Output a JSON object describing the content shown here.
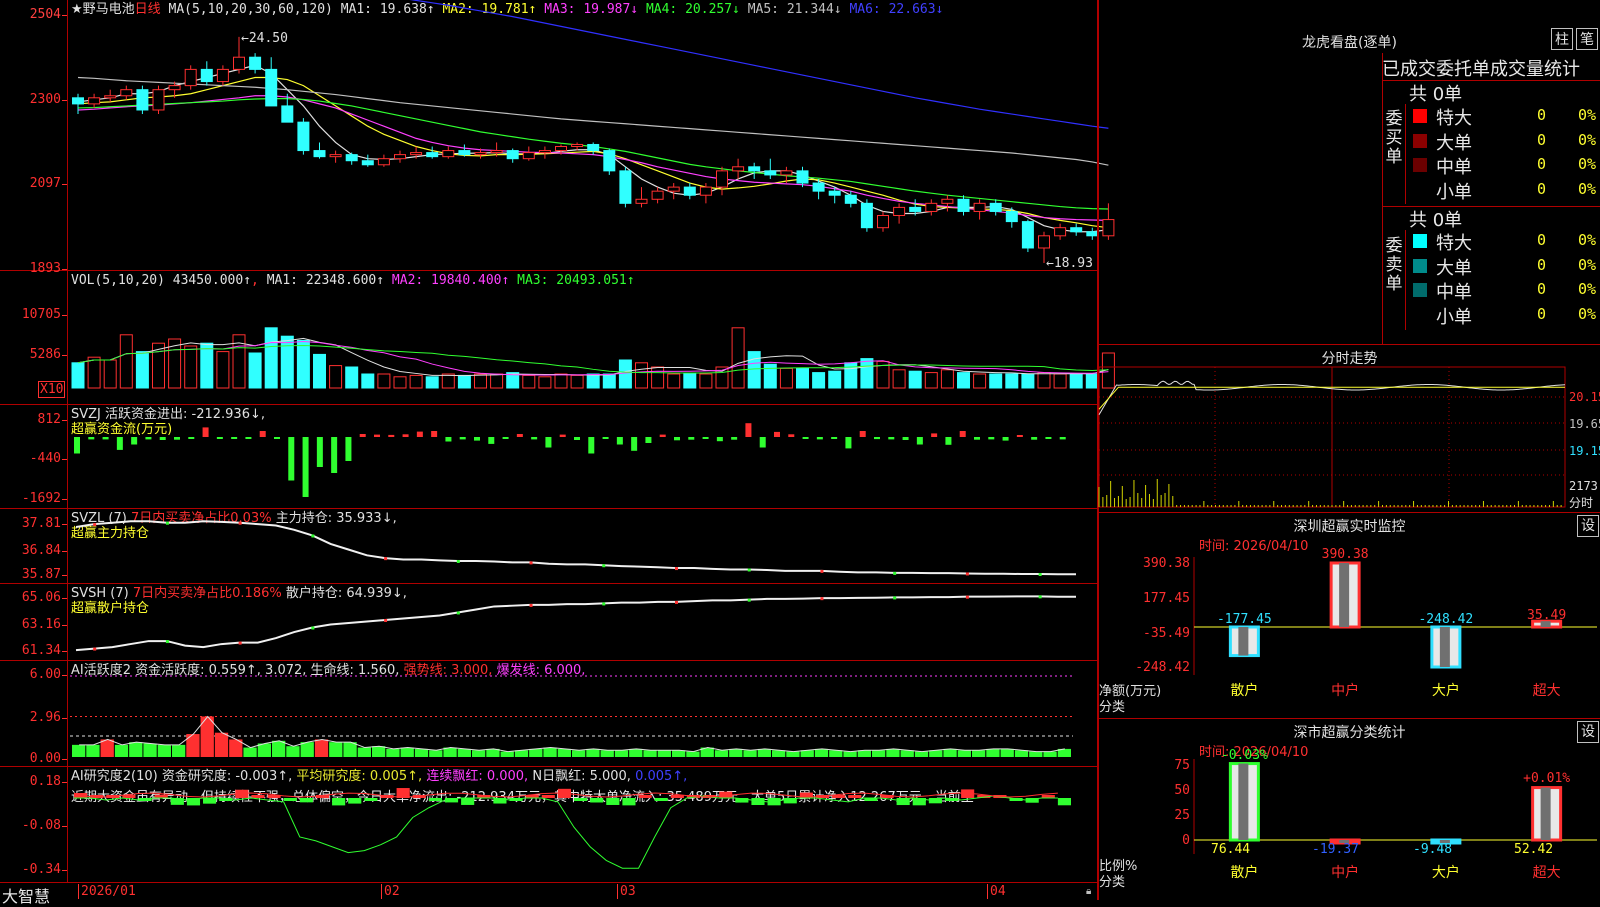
{
  "stock": {
    "name": "★野马电池",
    "period": "日线",
    "ma_label": "MA(5,10,20,30,60,120)",
    "ma": [
      {
        "label": "MA1: 19.638↑",
        "color": "#e0e0e0"
      },
      {
        "label": "MA2: 19.781↑",
        "color": "#ffff30"
      },
      {
        "label": "MA3: 19.987↓",
        "color": "#ff40ff"
      },
      {
        "label": "MA4: 20.257↓",
        "color": "#30ff30"
      },
      {
        "label": "MA5: 21.344↓",
        "color": "#c0c0c0"
      },
      {
        "label": "MA6: 22.663↓",
        "color": "#4040ff"
      }
    ],
    "price_ticks": [
      "2504",
      "2300",
      "2097",
      "1893"
    ],
    "high_label": "24.50",
    "low_label": "18.93",
    "candles": [
      [
        23.0,
        23.1,
        22.6,
        22.85
      ],
      [
        22.85,
        23.1,
        22.75,
        23.0
      ],
      [
        23.0,
        23.2,
        22.9,
        23.05
      ],
      [
        23.05,
        23.3,
        22.95,
        23.2
      ],
      [
        23.2,
        23.3,
        22.6,
        22.7
      ],
      [
        22.7,
        23.3,
        22.6,
        23.2
      ],
      [
        23.2,
        23.4,
        23.0,
        23.3
      ],
      [
        23.3,
        23.8,
        23.2,
        23.7
      ],
      [
        23.7,
        23.9,
        23.3,
        23.4
      ],
      [
        23.4,
        23.8,
        23.3,
        23.7
      ],
      [
        23.7,
        24.5,
        23.6,
        24.0
      ],
      [
        24.0,
        24.1,
        23.6,
        23.7
      ],
      [
        23.7,
        24.0,
        23.2,
        22.8
      ],
      [
        22.8,
        23.1,
        22.4,
        22.4
      ],
      [
        22.4,
        22.5,
        21.6,
        21.7
      ],
      [
        21.7,
        21.9,
        21.5,
        21.55
      ],
      [
        21.55,
        21.7,
        21.4,
        21.6
      ],
      [
        21.6,
        21.65,
        21.35,
        21.45
      ],
      [
        21.45,
        21.6,
        21.3,
        21.35
      ],
      [
        21.35,
        21.6,
        21.3,
        21.5
      ],
      [
        21.5,
        21.7,
        21.4,
        21.6
      ],
      [
        21.6,
        21.8,
        21.5,
        21.65
      ],
      [
        21.65,
        21.8,
        21.5,
        21.55
      ],
      [
        21.55,
        21.8,
        21.5,
        21.7
      ],
      [
        21.7,
        21.85,
        21.55,
        21.6
      ],
      [
        21.6,
        21.75,
        21.5,
        21.65
      ],
      [
        21.65,
        21.9,
        21.55,
        21.7
      ],
      [
        21.7,
        21.75,
        21.4,
        21.5
      ],
      [
        21.5,
        21.8,
        21.45,
        21.65
      ],
      [
        21.65,
        21.8,
        21.5,
        21.7
      ],
      [
        21.7,
        21.85,
        21.6,
        21.8
      ],
      [
        21.8,
        21.9,
        21.7,
        21.85
      ],
      [
        21.85,
        21.9,
        21.6,
        21.7
      ],
      [
        21.7,
        21.75,
        21.1,
        21.2
      ],
      [
        21.2,
        21.3,
        20.3,
        20.4
      ],
      [
        20.4,
        20.8,
        20.3,
        20.5
      ],
      [
        20.5,
        20.8,
        20.4,
        20.7
      ],
      [
        20.7,
        20.9,
        20.5,
        20.8
      ],
      [
        20.8,
        20.9,
        20.5,
        20.6
      ],
      [
        20.6,
        20.9,
        20.4,
        20.8
      ],
      [
        20.8,
        21.3,
        20.6,
        21.2
      ],
      [
        21.2,
        21.5,
        21.0,
        21.3
      ],
      [
        21.3,
        21.4,
        21.0,
        21.2
      ],
      [
        21.2,
        21.5,
        21.0,
        21.1
      ],
      [
        21.1,
        21.3,
        20.9,
        21.2
      ],
      [
        21.2,
        21.3,
        20.8,
        20.9
      ],
      [
        20.9,
        21.0,
        20.5,
        20.7
      ],
      [
        20.7,
        20.8,
        20.4,
        20.6
      ],
      [
        20.6,
        20.7,
        20.3,
        20.4
      ],
      [
        20.4,
        20.5,
        19.7,
        19.8
      ],
      [
        19.8,
        20.2,
        19.7,
        20.1
      ],
      [
        20.1,
        20.4,
        19.9,
        20.3
      ],
      [
        20.3,
        20.5,
        20.1,
        20.2
      ],
      [
        20.2,
        20.5,
        20.1,
        20.4
      ],
      [
        20.4,
        20.6,
        20.2,
        20.5
      ],
      [
        20.5,
        20.6,
        20.1,
        20.2
      ],
      [
        20.2,
        20.5,
        20.0,
        20.4
      ],
      [
        20.4,
        20.5,
        20.1,
        20.2
      ],
      [
        20.2,
        20.3,
        19.8,
        19.95
      ],
      [
        19.95,
        20.0,
        19.2,
        19.3
      ],
      [
        19.3,
        19.7,
        18.93,
        19.6
      ],
      [
        19.6,
        19.9,
        19.5,
        19.8
      ],
      [
        19.8,
        19.9,
        19.6,
        19.7
      ],
      [
        19.7,
        19.8,
        19.5,
        19.6
      ],
      [
        19.6,
        20.4,
        19.5,
        20.0
      ]
    ],
    "ma_series": {
      "ma1": [
        22.9,
        22.95,
        23.0,
        23.1,
        23.1,
        23.15,
        23.3,
        23.4,
        23.5,
        23.6,
        23.7,
        23.8,
        23.6,
        23.2,
        22.8,
        22.3,
        21.9,
        21.6,
        21.5,
        21.48,
        21.5,
        21.55,
        21.6,
        21.62,
        21.63,
        21.64,
        21.65,
        21.62,
        21.62,
        21.63,
        21.68,
        21.72,
        21.72,
        21.6,
        21.3,
        21.0,
        20.8,
        20.65,
        20.6,
        20.65,
        20.8,
        21.0,
        21.15,
        21.2,
        21.2,
        21.1,
        20.95,
        20.8,
        20.6,
        20.35,
        20.2,
        20.15,
        20.15,
        20.2,
        20.3,
        20.3,
        20.3,
        20.32,
        20.25,
        20.05,
        19.85,
        19.75,
        19.7,
        19.7,
        19.75
      ],
      "ma2": [
        22.85,
        22.88,
        22.9,
        22.95,
        23.0,
        23.02,
        23.05,
        23.1,
        23.2,
        23.3,
        23.4,
        23.5,
        23.5,
        23.45,
        23.3,
        23.05,
        22.8,
        22.55,
        22.3,
        22.1,
        21.95,
        21.8,
        21.7,
        21.62,
        21.58,
        21.57,
        21.6,
        21.6,
        21.61,
        21.62,
        21.64,
        21.66,
        21.68,
        21.62,
        21.5,
        21.35,
        21.2,
        21.05,
        20.9,
        20.8,
        20.75,
        20.78,
        20.82,
        20.88,
        20.95,
        21.0,
        20.98,
        20.9,
        20.8,
        20.7,
        20.6,
        20.48,
        20.38,
        20.32,
        20.3,
        20.28,
        20.26,
        20.25,
        20.22,
        20.15,
        20.05,
        19.98,
        19.92,
        19.85,
        19.8
      ],
      "ma3": [
        22.7,
        22.72,
        22.75,
        22.78,
        22.8,
        22.82,
        22.85,
        22.88,
        22.92,
        22.96,
        23.0,
        23.05,
        23.05,
        23.02,
        22.95,
        22.85,
        22.75,
        22.6,
        22.45,
        22.3,
        22.15,
        22.0,
        21.9,
        21.82,
        21.76,
        21.72,
        21.7,
        21.68,
        21.66,
        21.65,
        21.64,
        21.62,
        21.6,
        21.55,
        21.48,
        21.4,
        21.3,
        21.22,
        21.14,
        21.06,
        21.0,
        20.96,
        20.92,
        20.9,
        20.88,
        20.86,
        20.82,
        20.76,
        20.7,
        20.6,
        20.52,
        20.45,
        20.4,
        20.36,
        20.32,
        20.28,
        20.24,
        20.2,
        20.16,
        20.1,
        20.05,
        20.02,
        20.0,
        19.99,
        19.98
      ],
      "ma4": [
        22.75,
        22.76,
        22.78,
        22.8,
        22.82,
        22.84,
        22.86,
        22.88,
        22.9,
        22.92,
        22.95,
        22.97,
        22.98,
        22.98,
        22.96,
        22.92,
        22.86,
        22.8,
        22.72,
        22.64,
        22.56,
        22.48,
        22.4,
        22.32,
        22.24,
        22.16,
        22.1,
        22.04,
        21.98,
        21.93,
        21.88,
        21.84,
        21.8,
        21.74,
        21.68,
        21.6,
        21.52,
        21.44,
        21.36,
        21.3,
        21.25,
        21.2,
        21.16,
        21.12,
        21.08,
        21.05,
        21.02,
        20.98,
        20.94,
        20.88,
        20.82,
        20.76,
        20.7,
        20.65,
        20.6,
        20.56,
        20.52,
        20.48,
        20.44,
        20.4,
        20.36,
        20.32,
        20.29,
        20.27,
        20.26
      ],
      "ma5": [
        23.5,
        23.48,
        23.45,
        23.42,
        23.4,
        23.38,
        23.36,
        23.34,
        23.32,
        23.3,
        23.28,
        23.26,
        23.23,
        23.2,
        23.16,
        23.12,
        23.08,
        23.03,
        22.98,
        22.93,
        22.88,
        22.84,
        22.8,
        22.76,
        22.72,
        22.68,
        22.64,
        22.6,
        22.56,
        22.52,
        22.48,
        22.45,
        22.42,
        22.39,
        22.36,
        22.33,
        22.3,
        22.27,
        22.24,
        22.21,
        22.18,
        22.15,
        22.12,
        22.09,
        22.06,
        22.03,
        22.0,
        21.97,
        21.94,
        21.91,
        21.88,
        21.85,
        21.82,
        21.79,
        21.76,
        21.73,
        21.7,
        21.67,
        21.64,
        21.6,
        21.56,
        21.52,
        21.48,
        21.42,
        21.34
      ],
      "ma6": [
        25.8,
        25.82,
        25.83,
        25.84,
        25.85,
        25.86,
        25.86,
        25.86,
        25.85,
        25.84,
        25.83,
        25.82,
        25.8,
        25.77,
        25.74,
        25.7,
        25.66,
        25.62,
        25.57,
        25.52,
        25.46,
        25.4,
        25.34,
        25.28,
        25.21,
        25.14,
        25.07,
        25.0,
        24.92,
        24.84,
        24.76,
        24.68,
        24.6,
        24.52,
        24.44,
        24.36,
        24.28,
        24.2,
        24.12,
        24.04,
        23.96,
        23.88,
        23.8,
        23.72,
        23.64,
        23.56,
        23.48,
        23.4,
        23.32,
        23.24,
        23.16,
        23.08,
        23.0,
        22.93,
        22.86,
        22.79,
        22.72,
        22.66,
        22.6,
        22.54,
        22.48,
        22.42,
        22.36,
        22.3,
        22.25
      ]
    }
  },
  "volume": {
    "title": "VOL(5,10,20)",
    "value": "43450.000↑",
    "ma": [
      {
        "label": "MA1: 22348.600↑",
        "color": "#e0e0e0"
      },
      {
        "label": "MA2: 19840.400↑",
        "color": "#ff40ff"
      },
      {
        "label": "MA3: 20493.051↑",
        "color": "#30ff30"
      }
    ],
    "ticks": [
      "10705",
      "5286"
    ],
    "multiplier": "X10",
    "bars": [
      1.8,
      2.2,
      2.0,
      3.8,
      2.6,
      3.2,
      3.5,
      3.0,
      3.2,
      2.6,
      3.8,
      2.5,
      4.3,
      3.7,
      3.4,
      2.4,
      1.6,
      1.5,
      1.0,
      1.0,
      0.8,
      0.9,
      0.8,
      1.0,
      0.9,
      1.0,
      1.0,
      1.1,
      0.9,
      0.8,
      1.0,
      0.9,
      1.0,
      1.0,
      2.0,
      1.8,
      1.5,
      1.0,
      1.0,
      1.0,
      1.5,
      4.3,
      2.6,
      1.7,
      1.4,
      1.4,
      1.1,
      1.2,
      1.8,
      2.1,
      1.9,
      1.3,
      1.2,
      1.1,
      1.3,
      1.1,
      1.0,
      1.0,
      1.0,
      1.0,
      1.1,
      1.0,
      1.0,
      1.0,
      2.5
    ]
  },
  "svzj": {
    "title": "SVZJ  活跃资金进出: -212.936↓,",
    "subtitle": "超赢资金流(万元)",
    "ticks": [
      "812",
      "-440",
      "-1692"
    ],
    "bars": [
      -550,
      -80,
      -80,
      -430,
      -250,
      -80,
      -100,
      -90,
      -50,
      320,
      -30,
      -50,
      -60,
      200,
      -50,
      -1450,
      -2000,
      -1000,
      -1200,
      -800,
      100,
      80,
      70,
      90,
      180,
      200,
      -150,
      -80,
      -120,
      -230,
      -60,
      100,
      -80,
      -350,
      80,
      -100,
      -550,
      -60,
      -250,
      -460,
      -200,
      80,
      -110,
      -90,
      -60,
      -140,
      -90,
      460,
      -350,
      170,
      90,
      -60,
      -80,
      -30,
      -380,
      200,
      -70,
      -80,
      -100,
      -250,
      120,
      -260,
      200,
      -90,
      -80,
      -120,
      60,
      -90,
      -40,
      -80
    ]
  },
  "svzl": {
    "title": "SVZL  (7)",
    "mid": "7日内买卖净占比0.03%",
    "tail": "主力持仓: 35.933↓,",
    "subtitle": "超赢主力持仓",
    "ticks": [
      "37.81",
      "36.84",
      "35.87"
    ],
    "line": [
      37.6,
      37.7,
      37.75,
      37.8,
      37.8,
      37.75,
      37.75,
      37.8,
      37.78,
      37.75,
      37.7,
      37.65,
      37.5,
      37.3,
      37.0,
      36.8,
      36.6,
      36.5,
      36.45,
      36.45,
      36.42,
      36.4,
      36.4,
      36.38,
      36.35,
      36.35,
      36.3,
      36.28,
      36.28,
      36.25,
      36.22,
      36.2,
      36.18,
      36.15,
      36.15,
      36.12,
      36.1,
      36.1,
      36.08,
      36.05,
      36.05,
      36.05,
      36.02,
      36.0,
      36.0,
      35.98,
      35.98,
      35.97,
      35.97,
      35.96,
      35.95,
      35.95,
      35.94,
      35.94,
      35.93,
      35.93
    ]
  },
  "svsh": {
    "title": "SVSH  (7)",
    "mid": "7日内买卖净占比0.186%",
    "tail": "散户持仓: 64.939↓,",
    "subtitle": "超赢散户持仓",
    "ticks": [
      "65.06",
      "63.16",
      "61.34"
    ],
    "line": [
      61.4,
      61.5,
      61.6,
      61.8,
      62.0,
      62.0,
      61.7,
      61.6,
      61.8,
      61.9,
      61.9,
      62.2,
      62.6,
      62.9,
      63.1,
      63.2,
      63.3,
      63.4,
      63.5,
      63.6,
      63.7,
      63.9,
      64.1,
      64.3,
      64.35,
      64.4,
      64.4,
      64.45,
      64.45,
      64.5,
      64.55,
      64.55,
      64.6,
      64.6,
      64.65,
      64.7,
      64.7,
      64.75,
      64.8,
      64.8,
      64.82,
      64.85,
      64.85,
      64.87,
      64.88,
      64.9,
      64.9,
      64.92,
      64.92,
      64.95,
      64.95,
      64.96,
      64.97,
      64.97,
      64.94,
      64.94
    ]
  },
  "ai_activity": {
    "title": "AI活跃度2",
    "a": "资金活跃度: 0.559↑,",
    "b": "3.072,",
    "c": "生命线: 1.560,",
    "d": "强势线: 3.000,",
    "e": "爆发线: 6.000,",
    "ticks": [
      "6.00",
      "2.96",
      "0.00"
    ],
    "bars": [
      0.9,
      0.9,
      1.3,
      0.9,
      1.1,
      1.0,
      0.9,
      0.9,
      1.7,
      3.0,
      1.8,
      1.3,
      0.7,
      1.0,
      1.2,
      0.8,
      1.1,
      1.3,
      1.1,
      1.1,
      0.7,
      0.8,
      0.6,
      0.7,
      0.6,
      0.5,
      0.7,
      0.6,
      0.5,
      0.6,
      0.4,
      0.5,
      0.6,
      0.7,
      0.6,
      0.5,
      0.6,
      0.5,
      0.5,
      0.6,
      0.5,
      0.5,
      0.5,
      0.4,
      0.7,
      0.5,
      0.6,
      0.5,
      0.6,
      0.5,
      0.4,
      0.5,
      0.6,
      0.5,
      0.4,
      0.5,
      0.5,
      0.6,
      0.5,
      0.4,
      0.5,
      0.6,
      0.5,
      0.5,
      0.6,
      0.6,
      0.5,
      0.4,
      0.4,
      0.6
    ]
  },
  "ai_research": {
    "title": "AI研究度2(10)",
    "a": "资金研究度: -0.003↑,",
    "b": "平均研究度: 0.005↑,",
    "c": "连续飘红: 0.000,",
    "d": "N日飘红: 5.000,",
    "e": "0.005↑,",
    "comment": "近期大资金虽有异动，但持续性不强，总体偏空，今日大单净流出: -212.934万元，其中特大单净流入: 35.489万元，大单5日累计净入12.267万元，当前主",
    "ticks": [
      "0.18",
      "-0.08",
      "-0.34"
    ]
  },
  "dates": [
    "2026/01",
    "02",
    "03",
    "04"
  ],
  "brand": "大智慧",
  "longhu": {
    "title": "龙虎看盘(逐单)",
    "tab1": "柱",
    "tab2": "笔",
    "header": "已成交委托单成交量统计",
    "buy_total": "共 0单",
    "sell_total": "共 0单",
    "buy_label": [
      "委",
      "买",
      "单"
    ],
    "sell_label": [
      "委",
      "卖",
      "单"
    ],
    "buy_rows": [
      {
        "label": "特大",
        "count": "0",
        "pct": "0%",
        "color": "#ff0000"
      },
      {
        "label": "大单",
        "count": "0",
        "pct": "0%",
        "color": "#8b0000"
      },
      {
        "label": "中单",
        "count": "0",
        "pct": "0%",
        "color": "#6b0000"
      },
      {
        "label": "小单",
        "count": "0",
        "pct": "0%",
        "color": "#000000"
      }
    ],
    "sell_rows": [
      {
        "label": "特大",
        "count": "0",
        "pct": "0%",
        "color": "#00ffff"
      },
      {
        "label": "大单",
        "count": "0",
        "pct": "0%",
        "color": "#008b8b"
      },
      {
        "label": "中单",
        "count": "0",
        "pct": "0%",
        "color": "#006b6b"
      },
      {
        "label": "小单",
        "count": "0",
        "pct": "0%",
        "color": "#000000"
      }
    ]
  },
  "intraday": {
    "title": "分时走势",
    "ticks": [
      "20.15",
      "19.65",
      "19.15"
    ],
    "vol_label": "2173",
    "vol_sub": "分时"
  },
  "sz_monitor": {
    "title": "深圳超赢实时监控",
    "setting": "设",
    "date": "时间: 2026/04/10",
    "ticks": [
      "390.38",
      "177.45",
      "-35.49",
      "-248.42"
    ],
    "ylabel": "净额(万元)",
    "xlabel": "分类",
    "categories": [
      "散户",
      "中户",
      "大户",
      "超大"
    ],
    "values": [
      "-177.45",
      "390.38",
      "-248.42",
      "35.49"
    ]
  },
  "sz_class": {
    "title": "深市超赢分类统计",
    "setting": "设",
    "date": "时间: 2026/04/10",
    "ticks": [
      "75",
      "50",
      "25",
      "0"
    ],
    "ylabel": "比例%",
    "xlabel": "分类",
    "categories": [
      "散户",
      "中户",
      "大户",
      "超大"
    ],
    "bottom_values": [
      "76.44",
      "-19.37",
      "-9.48",
      "52.42"
    ],
    "top_labels": [
      "-0.03%",
      "+0.01%"
    ]
  },
  "chart_data": {
    "type": "bar",
    "title": "深圳超赢实时监控",
    "categories": [
      "散户",
      "中户",
      "大户",
      "超大"
    ],
    "values": [
      -177.45,
      390.38,
      -248.42,
      35.49
    ],
    "ylabel": "净额(万元)",
    "xlabel": "分类",
    "ylim": [
      -248.42,
      390.38
    ]
  }
}
